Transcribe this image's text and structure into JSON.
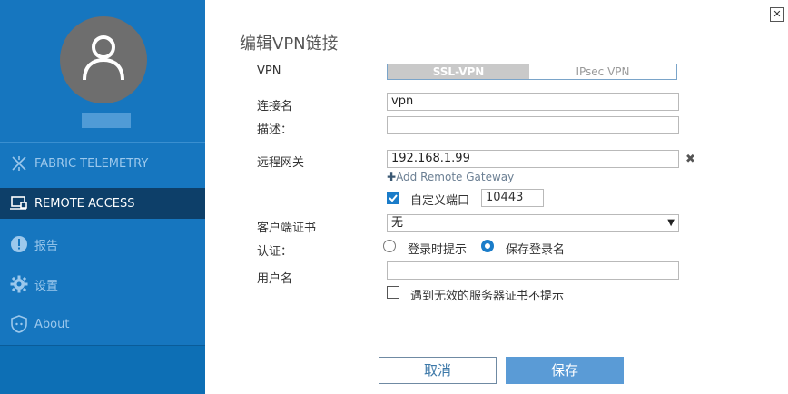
{
  "sidebar": {
    "nav": [
      {
        "label": "FABRIC TELEMETRY",
        "icon": "fabric-telemetry-icon"
      },
      {
        "label": "REMOTE ACCESS",
        "icon": "remote-access-icon",
        "active": true
      },
      {
        "label": "报告",
        "icon": "alert-icon"
      },
      {
        "label": "设置",
        "icon": "gear-icon"
      },
      {
        "label": "About",
        "icon": "shield-icon"
      }
    ]
  },
  "form": {
    "title": "编辑VPN链接",
    "vpn_label": "VPN",
    "vpn_options": [
      "SSL-VPN",
      "IPsec VPN"
    ],
    "connection_name_label": "连接名",
    "connection_name_value": "vpn",
    "description_label": "描述：",
    "description_value": "",
    "remote_gateway_label": "远程网关",
    "remote_gateway_value": "192.168.1.99",
    "add_remote_gateway": "Add Remote Gateway",
    "custom_port_label": "自定义端口",
    "custom_port_checked": true,
    "custom_port_value": "10443",
    "client_cert_label": "客户端证书",
    "client_cert_value": "无",
    "auth_label": "认证：",
    "auth_options": [
      "登录时提示",
      "保存登录名"
    ],
    "auth_selected": "保存登录名",
    "username_label": "用户名",
    "username_value": "",
    "ignore_cert_label": "遇到无效的服务器证书不提示",
    "ignore_cert_checked": false
  },
  "buttons": {
    "cancel": "取消",
    "save": "保存"
  },
  "colors": {
    "sidebar": "#1676bf",
    "sidebar_active": "#0d3f69",
    "accent": "#1a7cc9",
    "save_button": "#5a9bd6"
  }
}
